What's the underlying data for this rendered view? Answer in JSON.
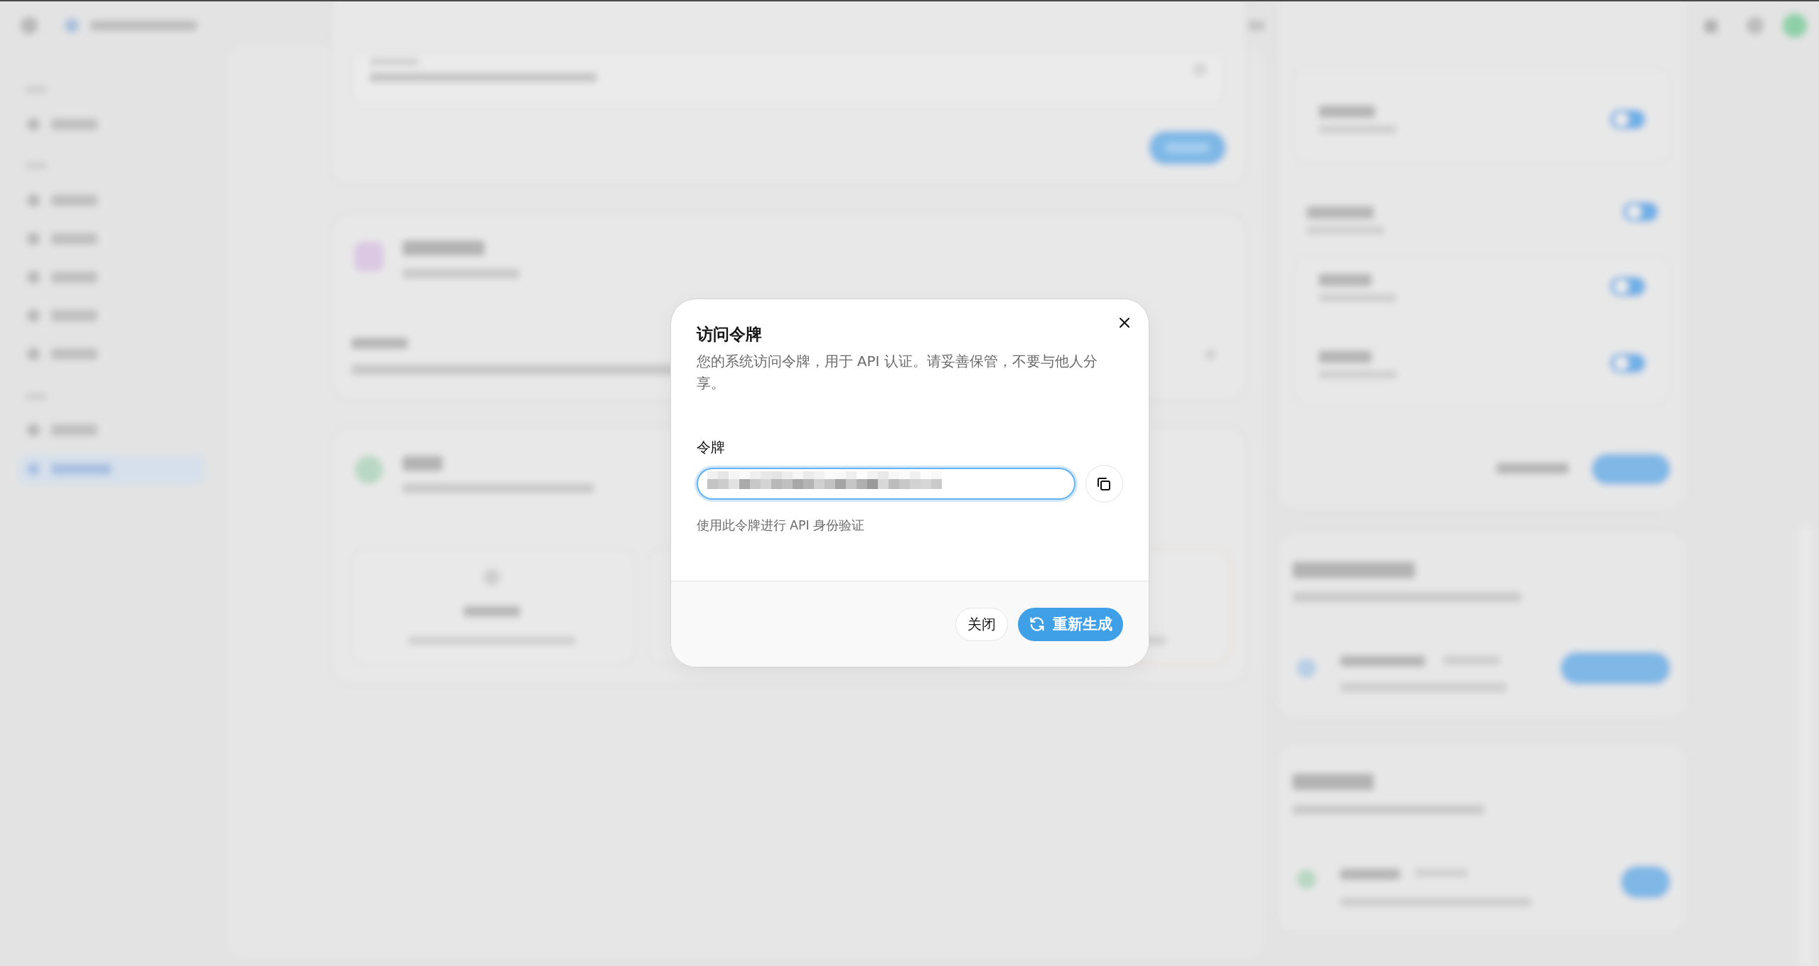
{
  "dialog": {
    "title": "访问令牌",
    "description": "您的系统访问令牌，用于 API 认证。请妥善保管，不要与他人分享。",
    "token_field": {
      "label": "令牌",
      "focused": true,
      "redacted": true,
      "help": "使用此令牌进行 API 身份验证"
    },
    "buttons": [
      {
        "kind": "secondary",
        "label": "关闭"
      },
      {
        "kind": "primary",
        "label": "重新生成"
      }
    ]
  }
}
